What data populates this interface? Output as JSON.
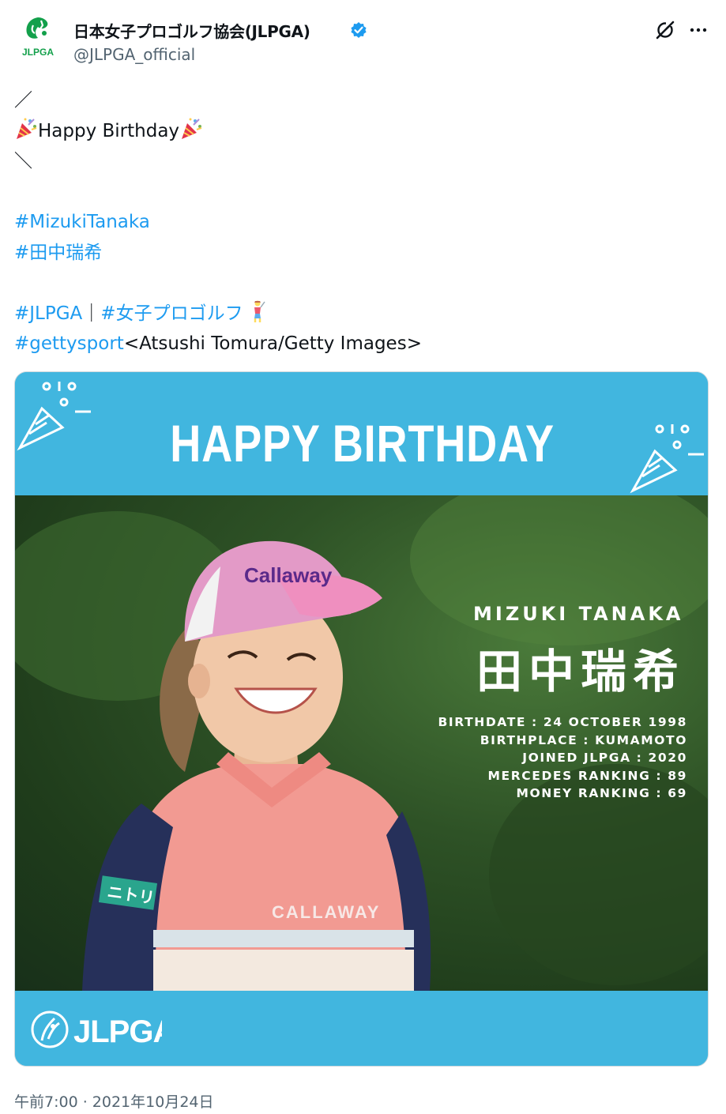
{
  "account": {
    "avatar_text": "JLPGA",
    "display_name": "日本女子プロゴルフ協会(JLPGA)",
    "handle": "@JLPGA_official",
    "verified": true,
    "brand_color": "#13a04b",
    "verified_color": "#1d9bf0"
  },
  "tweet": {
    "line_open": "／",
    "birthday_text": "Happy Birthday",
    "line_close": "＼",
    "hashtag_name_en": "#MizukiTanaka",
    "hashtag_name_jp": "#田中瑞希",
    "hashtag_jlpga": "#JLPGA",
    "separator": "｜",
    "hashtag_golf": "#女子プロゴルフ",
    "hashtag_getty": "#gettysport",
    "credit": "<Atsushi Tomura/Getty Images>",
    "hashtag_color": "#1d9bf0",
    "icons": {
      "party": "party-popper-emoji",
      "golfer": "woman-golfing-emoji"
    }
  },
  "media": {
    "banner_title": "HAPPY BIRTHDAY",
    "player_name_en": "MIZUKI TANAKA",
    "player_name_jp": "田中瑞希",
    "stats": [
      "BIRTHDATE : 24 OCTOBER 1998",
      "BIRTHPLACE : KUMAMOTO",
      "JOINED JLPGA : 2020",
      "MERCEDES RANKING : 89",
      "MONEY RANKING : 69"
    ],
    "brand": "JLPGA",
    "shirt_text": "CALLAWAY",
    "cap_text": "Callaway",
    "patch_text": "ニトリ",
    "banner_color": "#41b6df"
  },
  "timestamp": "午前7:00 · 2021年10月24日"
}
